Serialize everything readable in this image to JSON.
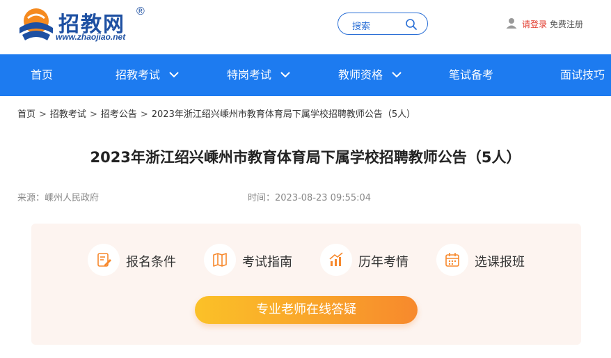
{
  "brand": {
    "name": "招教网",
    "registered": "®",
    "url": "www.zhaojiao.net",
    "color": "#1e50a2"
  },
  "search": {
    "label": "搜索"
  },
  "user": {
    "login": "请登录",
    "register": "免费注册"
  },
  "nav": {
    "background": "#1d7bf0",
    "items": [
      {
        "label": "首页",
        "has_dropdown": false
      },
      {
        "label": "招教考试",
        "has_dropdown": true
      },
      {
        "label": "特岗考试",
        "has_dropdown": true
      },
      {
        "label": "教师资格",
        "has_dropdown": true
      },
      {
        "label": "笔试备考",
        "has_dropdown": false
      },
      {
        "label": "面试技巧",
        "has_dropdown": false
      }
    ]
  },
  "breadcrumb": {
    "items": [
      "首页",
      "招教考试",
      "招考公告",
      "2023年浙江绍兴嵊州市教育体育局下属学校招聘教师公告（5人）"
    ],
    "separator": ">"
  },
  "article": {
    "title": "2023年浙江绍兴嵊州市教育体育局下属学校招聘教师公告（5人）",
    "source": "来源：嵊州人民政府",
    "time": "时间：2023-08-23 09:55:04"
  },
  "features": {
    "items": [
      {
        "label": "报名条件",
        "icon": "edit-form-icon"
      },
      {
        "label": "考试指南",
        "icon": "book-map-icon"
      },
      {
        "label": "历年考情",
        "icon": "bar-chart-icon"
      },
      {
        "label": "选课报班",
        "icon": "calendar-icon"
      }
    ],
    "cta": "专业老师在线答疑",
    "accent": "#f7892d"
  }
}
